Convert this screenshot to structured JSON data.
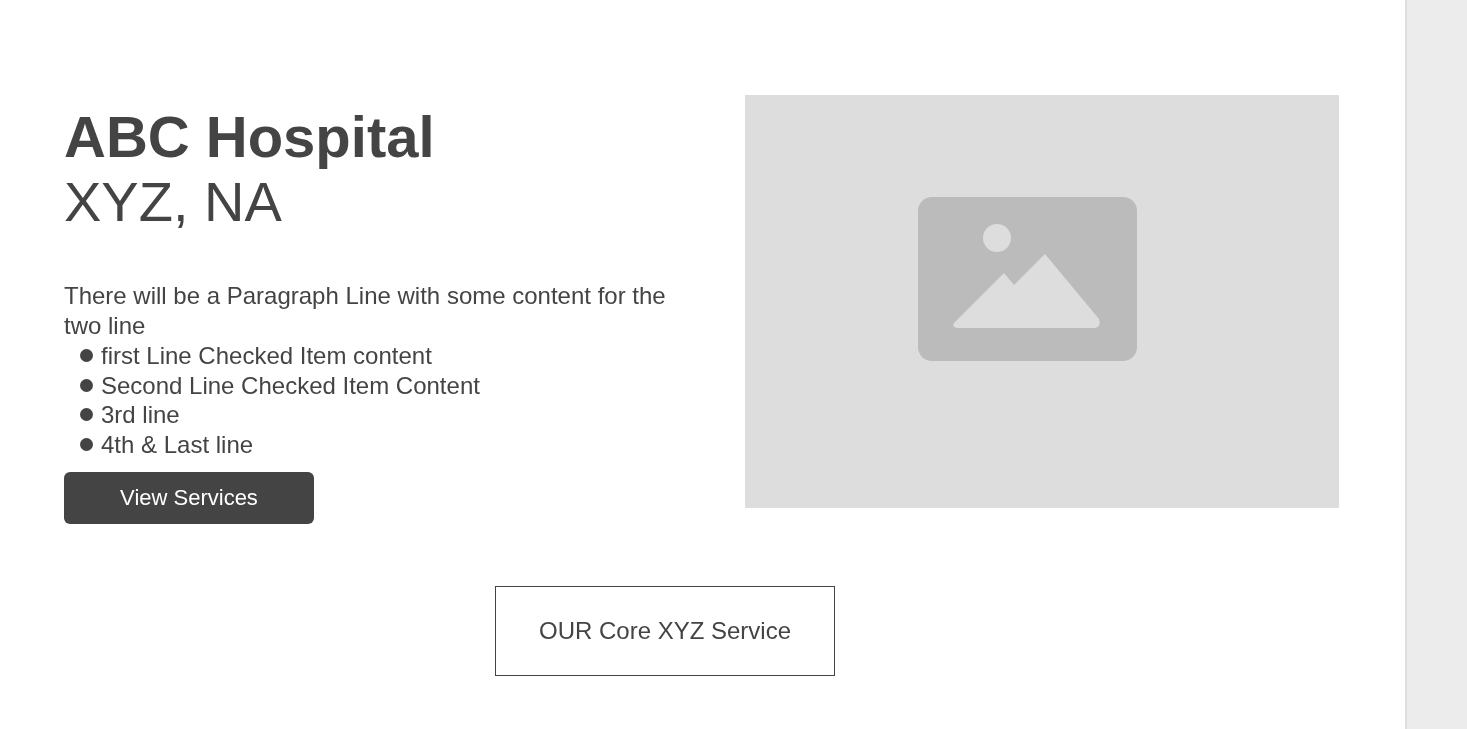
{
  "hero": {
    "title": "ABC Hospital",
    "subtitle": "XYZ, NA",
    "paragraph": "There will be a Paragraph Line with some content for the two line",
    "items": [
      "first Line Checked Item content",
      "Second Line Checked Item Content",
      "3rd line",
      "4th & Last line"
    ],
    "button": "View Services"
  },
  "section": {
    "heading": "OUR Core XYZ Service"
  }
}
